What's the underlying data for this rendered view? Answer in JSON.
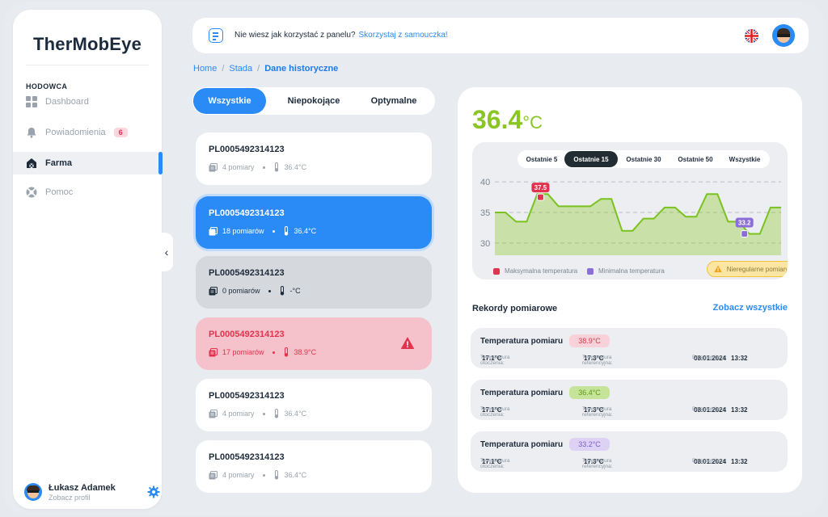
{
  "app": {
    "name": "TherMobEye"
  },
  "sidebar": {
    "section": "HODOWCA",
    "items": [
      {
        "label": "Dashboard",
        "icon": "grid-icon"
      },
      {
        "label": "Powiadomienia",
        "icon": "bell-icon",
        "badge": "6"
      },
      {
        "label": "Farma",
        "icon": "barn-icon",
        "active": true
      },
      {
        "label": "Pomoc",
        "icon": "lifebuoy-icon"
      }
    ],
    "profile": {
      "name": "Łukasz Adamek",
      "subtitle": "Zobacz profil"
    }
  },
  "topbar": {
    "hint": "Nie wiesz jak korzystać z panelu?",
    "hint_link": "Skorzystaj z samouczka!"
  },
  "breadcrumb": [
    "Home",
    "Stada",
    "Dane historyczne"
  ],
  "filters": {
    "tabs": [
      "Wszystkie",
      "Niepokojące",
      "Optymalne"
    ],
    "active": "Wszystkie"
  },
  "herds": [
    {
      "id": "PL0005492314123",
      "measurements": "4 pomiary",
      "temp": "36.4°C",
      "state": "normal"
    },
    {
      "id": "PL0005492314123",
      "measurements": "18 pomiarów",
      "temp": "36.4°C",
      "state": "selected"
    },
    {
      "id": "PL0005492314123",
      "measurements": "0 pomiarów",
      "temp": "-°C",
      "state": "empty"
    },
    {
      "id": "PL0005492314123",
      "measurements": "17 pomiarów",
      "temp": "38.9°C",
      "state": "alert"
    },
    {
      "id": "PL0005492314123",
      "measurements": "4 pomiary",
      "temp": "36.4°C",
      "state": "normal"
    },
    {
      "id": "PL0005492314123",
      "measurements": "4 pomiary",
      "temp": "36.4°C",
      "state": "normal"
    }
  ],
  "detail": {
    "temp_value": "36.4",
    "temp_unit": "°C",
    "period_tabs": [
      "Ostatnie 5",
      "Ostatnie 15",
      "Ostatnie 30",
      "Ostatnie 50",
      "Wszystkie"
    ],
    "period_active": "Ostatnie 15",
    "legend": {
      "max": "Maksymalna temperatura",
      "min": "Minimalna temperatura",
      "irregular": "Nieregularne pomiary"
    },
    "records_title": "Rekordy pomiarowe",
    "see_all": "Zobacz wszystkie",
    "records": [
      {
        "label": "Temperatura pomiaru",
        "value": "38.9°C",
        "status": "high",
        "ambient_label": "Temperatura otoczenia:",
        "ambient": "17.1°C",
        "ref_label": "Temperatura referencyjna:",
        "ref": "17.3°C",
        "date_label": "Data pomiaru:",
        "date": "08.01.2024",
        "time": "13:32"
      },
      {
        "label": "Temperatura pomiaru",
        "value": "36.4°C",
        "status": "ok",
        "ambient_label": "Temperatura otoczenia:",
        "ambient": "17.1°C",
        "ref_label": "Temperatura referencyjna:",
        "ref": "17.3°C",
        "date_label": "Data pomiaru:",
        "date": "08.01.2024",
        "time": "13:32"
      },
      {
        "label": "Temperatura pomiaru",
        "value": "33.2°C",
        "status": "low",
        "ambient_label": "Temperatura otoczenia:",
        "ambient": "17.1°C",
        "ref_label": "Temperatura referencyjna:",
        "ref": "17.3°C",
        "date_label": "Data pomiaru:",
        "date": "08.01.2024",
        "time": "13:32"
      }
    ]
  },
  "colors": {
    "accent": "#2a8af6",
    "ok": "#8ac623",
    "alert": "#e2324e",
    "low": "#8b6fd6",
    "warn": "#f1c33a"
  },
  "chart_data": {
    "type": "area",
    "ylim": [
      28,
      42
    ],
    "yticks": [
      30,
      35,
      40
    ],
    "grid": true,
    "series": [
      {
        "values": [
          35,
          35,
          33.5,
          33.5,
          38,
          38,
          36,
          36,
          36,
          36,
          37.2,
          37.2,
          32,
          32,
          34,
          34,
          35.8,
          35.8,
          34.3,
          34.3,
          38,
          38,
          33.5,
          33.5,
          31.5,
          31.5,
          35.8,
          35.8
        ]
      }
    ],
    "annotations": [
      {
        "label": "37.5",
        "index": 5,
        "value": 37.5,
        "kind": "max"
      },
      {
        "label": "33.2",
        "index": 24,
        "value": 31.5,
        "kind": "min"
      }
    ]
  }
}
